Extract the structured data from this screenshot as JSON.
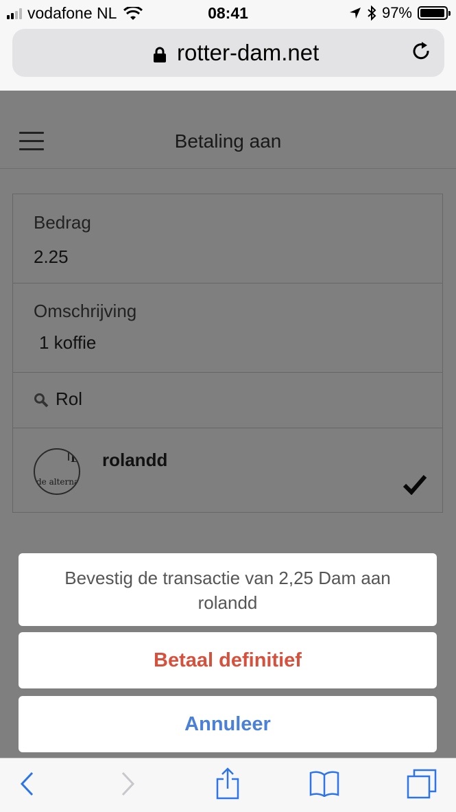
{
  "status_bar": {
    "carrier": "vodafone NL",
    "time": "08:41",
    "battery": "97%",
    "battery_level": 0.97
  },
  "browser": {
    "url": "rotter-dam.net"
  },
  "page": {
    "title": "Betaling aan",
    "amount_label": "Bedrag",
    "amount_value": "2.25",
    "description_label": "Omschrijving",
    "description_value": "1 koffie",
    "search_value": "Rol",
    "recipient": {
      "username": "rolandd",
      "avatar_text": "de alternа"
    }
  },
  "action_sheet": {
    "message_line1": "Bevestig de transactie van 2,25 Dam aan",
    "message_line2": "rolandd",
    "confirm_label": "Betaal definitief",
    "cancel_label": "Annuleer"
  },
  "colors": {
    "confirm": "#d6503b",
    "cancel": "#4a80d8",
    "toolbar_icon": "#2d74e8"
  },
  "icons": [
    "signal-icon",
    "wifi-icon",
    "location-arrow-icon",
    "bluetooth-icon",
    "battery-icon",
    "lock-icon",
    "reload-icon",
    "hamburger-menu-icon",
    "search-icon",
    "checkmark-icon",
    "back-icon",
    "forward-icon",
    "share-icon",
    "bookmarks-icon",
    "tabs-icon"
  ]
}
